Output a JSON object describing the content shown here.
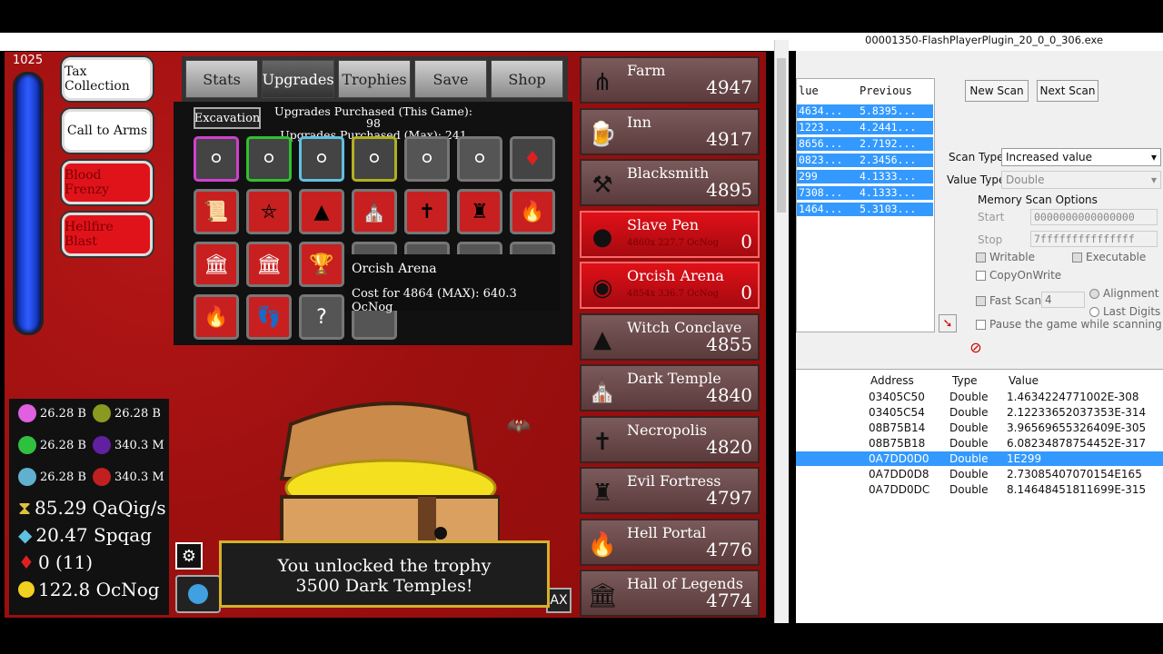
{
  "window": {
    "title": "00001350-FlashPlayerPlugin_20_0_0_306.exe"
  },
  "mana": {
    "value": "1025",
    "fill": 1.0
  },
  "spells": [
    {
      "label": "Tax Collection",
      "active": false
    },
    {
      "label": "Call to Arms",
      "active": false
    },
    {
      "label": "Blood Frenzy",
      "active": true
    },
    {
      "label": "Hellfire Blast",
      "active": true
    }
  ],
  "tabs": [
    "Stats",
    "Upgrades",
    "Trophies",
    "Save",
    "Shop"
  ],
  "active_tab": "Upgrades",
  "upgrades": {
    "excavation_label": "Excavation",
    "purchased_game": "Upgrades Purchased (This Game): 98",
    "purchased_max": "Upgrades Purchased (Max): 241"
  },
  "tooltip": {
    "title": "Orcish Arena",
    "cost": "Cost for 4864 (MAX): 640.3 OcNog"
  },
  "buildings": [
    {
      "name": "Farm",
      "count": "4947",
      "icon": "pitchfork-icon",
      "highlight": false
    },
    {
      "name": "Inn",
      "count": "4917",
      "icon": "mug-icon",
      "highlight": false
    },
    {
      "name": "Blacksmith",
      "count": "4895",
      "icon": "anvil-icon",
      "highlight": false
    },
    {
      "name": "Slave Pen",
      "count": "0",
      "sub": "4860x 227.7 OcNog",
      "icon": "ball-and-chain-icon",
      "highlight": true
    },
    {
      "name": "Orcish Arena",
      "count": "0",
      "sub": "4854x 336.7 OcNog",
      "icon": "arena-icon",
      "highlight": true
    },
    {
      "name": "Witch Conclave",
      "count": "4855",
      "icon": "witch-hat-icon",
      "highlight": false
    },
    {
      "name": "Dark Temple",
      "count": "4840",
      "icon": "temple-icon",
      "highlight": false
    },
    {
      "name": "Necropolis",
      "count": "4820",
      "icon": "tombstone-icon",
      "highlight": false
    },
    {
      "name": "Evil Fortress",
      "count": "4797",
      "icon": "fortress-icon",
      "highlight": false
    },
    {
      "name": "Hell Portal",
      "count": "4776",
      "icon": "flame-icon",
      "highlight": false
    },
    {
      "name": "Hall of Legends",
      "count": "4774",
      "icon": "hall-icon",
      "highlight": false
    }
  ],
  "resources": {
    "gems": [
      {
        "value": "26.28 B",
        "color": "#e060e0"
      },
      {
        "value": "26.28 B",
        "color": "#8a9a20"
      },
      {
        "value": "26.28 B",
        "color": "#30c040"
      },
      {
        "value": "340.3 M",
        "color": "#6020a0"
      },
      {
        "value": "26.28 B",
        "color": "#60b0d0"
      },
      {
        "value": "340.3 M",
        "color": "#c02020"
      }
    ],
    "rate": "85.29 QaQig/s",
    "spqag": "20.47 Spqag",
    "rubies": "0 (11)",
    "gold": "122.8 OcNog"
  },
  "trophy": {
    "line1": "You unlocked the trophy",
    "line2": "3500 Dark Temples!"
  },
  "ce": {
    "col_value": "lue",
    "col_previous": "Previous",
    "scan_rows": [
      {
        "v": "4634...",
        "p": "5.8395..."
      },
      {
        "v": "1223...",
        "p": "4.2441..."
      },
      {
        "v": "8656...",
        "p": "2.7192..."
      },
      {
        "v": "0823...",
        "p": "2.3456..."
      },
      {
        "v": "299",
        "p": "4.1333..."
      },
      {
        "v": "7308...",
        "p": "4.1333..."
      },
      {
        "v": "1464...",
        "p": "5.3103..."
      }
    ],
    "new_scan": "New Scan",
    "next_scan": "Next Scan",
    "scan_type_label": "Scan Type",
    "scan_type_value": "Increased value",
    "value_type_label": "Value Type",
    "value_type_value": "Double",
    "mem_opts": "Memory Scan Options",
    "start_label": "Start",
    "start_value": "0000000000000000",
    "stop_label": "Stop",
    "stop_value": "7fffffffffffffff",
    "writable": "Writable",
    "executable": "Executable",
    "copyonwrite": "CopyOnWrite",
    "fastscan": "Fast Scan",
    "fastscan_value": "4",
    "alignment": "Alignment",
    "lastdigits": "Last Digits",
    "pause": "Pause the game while scanning",
    "addr_headers": [
      "Address",
      "Type",
      "Value"
    ],
    "addr_rows": [
      {
        "a": "03405C50",
        "t": "Double",
        "v": "1.4634224771002E-308",
        "sel": false
      },
      {
        "a": "03405C54",
        "t": "Double",
        "v": "2.12233652037353E-314",
        "sel": false
      },
      {
        "a": "08B75B14",
        "t": "Double",
        "v": "3.96569655326409E-305",
        "sel": false
      },
      {
        "a": "08B75B18",
        "t": "Double",
        "v": "6.08234878754452E-317",
        "sel": false
      },
      {
        "a": "0A7DD0D0",
        "t": "Double",
        "v": "1E299",
        "sel": true
      },
      {
        "a": "0A7DD0D8",
        "t": "Double",
        "v": "2.73085407070154E165",
        "sel": false
      },
      {
        "a": "0A7DD0DC",
        "t": "Double",
        "v": "8.14648451811699E-315",
        "sel": false
      }
    ]
  }
}
